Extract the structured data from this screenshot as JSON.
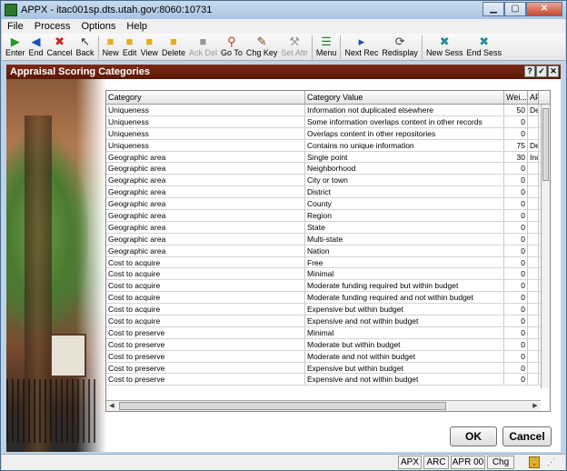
{
  "window": {
    "title": "APPX - itac001sp.dts.utah.gov:8060:10731"
  },
  "menu": [
    "File",
    "Process",
    "Options",
    "Help"
  ],
  "toolbar": [
    {
      "name": "enter",
      "label": "Enter",
      "icon": "play-icon",
      "color": "#1f9a2a",
      "enabled": true
    },
    {
      "name": "end",
      "label": "End",
      "icon": "back-arrow-icon",
      "color": "#1c4fb8",
      "enabled": true
    },
    {
      "name": "cancel",
      "label": "Cancel",
      "icon": "cancel-icon",
      "color": "#d02020",
      "enabled": true
    },
    {
      "name": "back",
      "label": "Back",
      "icon": "cursor-back-icon",
      "color": "#333333",
      "enabled": true
    },
    {
      "name": "new",
      "label": "New",
      "icon": "new-folder-icon",
      "color": "#e0b020",
      "enabled": true
    },
    {
      "name": "edit",
      "label": "Edit",
      "icon": "edit-folder-icon",
      "color": "#e0b020",
      "enabled": true
    },
    {
      "name": "view",
      "label": "View",
      "icon": "view-folder-icon",
      "color": "#e0b020",
      "enabled": true
    },
    {
      "name": "delete",
      "label": "Delete",
      "icon": "delete-folder-icon",
      "color": "#e0b020",
      "enabled": true
    },
    {
      "name": "ack-del",
      "label": "Ack Del",
      "icon": "ack-delete-icon",
      "color": "#999999",
      "enabled": false
    },
    {
      "name": "go-to",
      "label": "Go To",
      "icon": "magnifier-icon",
      "color": "#b04010",
      "enabled": true
    },
    {
      "name": "chg-key",
      "label": "Chg Key",
      "icon": "brush-icon",
      "color": "#6a4a20",
      "enabled": true
    },
    {
      "name": "set-attr",
      "label": "Set Attr",
      "icon": "hammer-icon",
      "color": "#999999",
      "enabled": false
    },
    {
      "name": "menu",
      "label": "Menu",
      "icon": "menu-list-icon",
      "color": "#2a7a2a",
      "enabled": true
    },
    {
      "name": "next-rec",
      "label": "Next Rec",
      "icon": "next-arrow-icon",
      "color": "#1c4fb8",
      "enabled": true
    },
    {
      "name": "redisplay",
      "label": "Redisplay",
      "icon": "redisplay-icon",
      "color": "#444444",
      "enabled": true
    },
    {
      "name": "new-sess",
      "label": "New Sess",
      "icon": "new-session-icon",
      "color": "#2a8a9a",
      "enabled": true
    },
    {
      "name": "end-sess",
      "label": "End Sess",
      "icon": "end-session-icon",
      "color": "#2a8a9a",
      "enabled": true
    }
  ],
  "panel": {
    "title": "Appraisal Scoring Categories",
    "help_label": "?",
    "check_label": "✓",
    "close_label": "✕"
  },
  "grid": {
    "columns": [
      "Category",
      "Category Value",
      "Wei...",
      "AP"
    ],
    "rows": [
      [
        "Uniqueness",
        "Information not duplicated elsewhere",
        "50",
        "De"
      ],
      [
        "Uniqueness",
        "Some information overlaps content in other records",
        "0",
        ""
      ],
      [
        "Uniqueness",
        "Overlaps content in other repositories",
        "0",
        ""
      ],
      [
        "Uniqueness",
        "Contains no unique information",
        "75",
        "De"
      ],
      [
        "Geographic area",
        "Single point",
        "30",
        "Inc"
      ],
      [
        "Geographic area",
        "Neighborhood",
        "0",
        ""
      ],
      [
        "Geographic area",
        "City or town",
        "0",
        ""
      ],
      [
        "Geographic area",
        "District",
        "0",
        ""
      ],
      [
        "Geographic area",
        "County",
        "0",
        ""
      ],
      [
        "Geographic area",
        "Region",
        "0",
        ""
      ],
      [
        "Geographic area",
        "State",
        "0",
        ""
      ],
      [
        "Geographic area",
        "Multi-state",
        "0",
        ""
      ],
      [
        "Geographic area",
        "Nation",
        "0",
        ""
      ],
      [
        "Cost to acquire",
        "Free",
        "0",
        ""
      ],
      [
        "Cost to acquire",
        "Minimal",
        "0",
        ""
      ],
      [
        "Cost to acquire",
        "Moderate funding required but within budget",
        "0",
        ""
      ],
      [
        "Cost to acquire",
        "Moderate funding required and not within budget",
        "0",
        ""
      ],
      [
        "Cost to acquire",
        "Expensive but within budget",
        "0",
        ""
      ],
      [
        "Cost to acquire",
        "Expensive and not within budget",
        "0",
        ""
      ],
      [
        "Cost to preserve",
        "Minimal",
        "0",
        ""
      ],
      [
        "Cost to preserve",
        "Moderate but within budget",
        "0",
        ""
      ],
      [
        "Cost to preserve",
        "Moderate and not within budget",
        "0",
        ""
      ],
      [
        "Cost to preserve",
        "Expensive but within budget",
        "0",
        ""
      ],
      [
        "Cost to preserve",
        "Expensive and not within budget",
        "0",
        ""
      ]
    ]
  },
  "buttons": {
    "ok": "OK",
    "cancel": "Cancel"
  },
  "status": {
    "apx": "APX",
    "arc": "ARC",
    "apr": "APR 00",
    "mode": "Chg"
  }
}
